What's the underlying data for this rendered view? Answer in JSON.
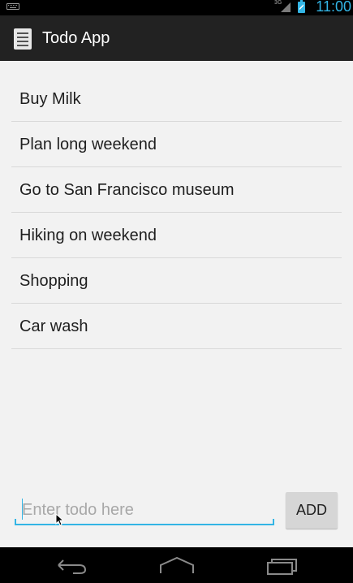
{
  "status_bar": {
    "network_label": "3G",
    "time": "11:00",
    "icons": [
      "keyboard-icon",
      "signal-icon",
      "battery-icon"
    ]
  },
  "action_bar": {
    "title": "Todo App",
    "icon": "notepad-icon"
  },
  "todos": {
    "items": [
      "Buy Milk",
      "Plan long weekend",
      "Go to San Francisco museum",
      "Hiking on weekend",
      "Shopping",
      "Car wash"
    ]
  },
  "input": {
    "placeholder": "Enter todo here",
    "value": ""
  },
  "add_button": {
    "label": "ADD"
  },
  "nav_bar": {
    "buttons": [
      "back-icon",
      "home-icon",
      "recent-apps-icon"
    ]
  },
  "colors": {
    "accent": "#33b5e5",
    "action_bar": "#222222",
    "background": "#f2f2f2"
  }
}
